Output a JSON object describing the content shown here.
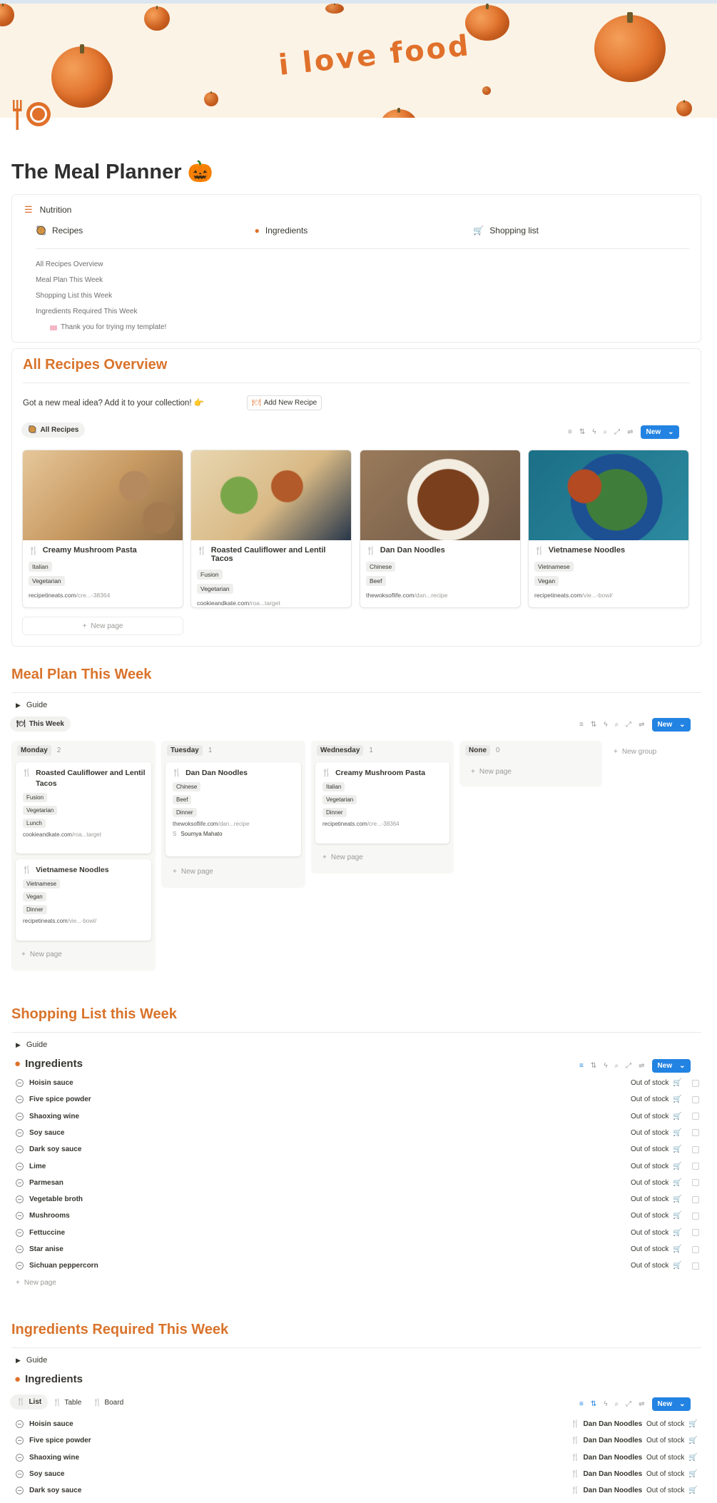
{
  "cover": {
    "text": "i love food"
  },
  "page": {
    "title": "The Meal Planner",
    "title_emoji": "🎃"
  },
  "nutrition": {
    "label": "Nutrition",
    "links": [
      {
        "label": "Recipes"
      },
      {
        "label": "Ingredients"
      },
      {
        "label": "Shopping list"
      }
    ],
    "toc": [
      "All Recipes Overview",
      "Meal Plan This Week",
      "Shopping List this Week",
      "Ingredients Required This Week"
    ],
    "thanks": "Thank you for trying my template!"
  },
  "recipes": {
    "heading": "All Recipes Overview",
    "prompt": "Got a new meal idea? Add it to your collection! 👉",
    "add_button": "Add New Recipe",
    "view": "All Recipes",
    "new_label": "New",
    "new_page": "New page",
    "cards": [
      {
        "title": "Creamy Mushroom Pasta",
        "tags": [
          "Italian",
          "Vegetarian"
        ],
        "url": "recipetineats.com",
        "url_suffix": "/cre...-38364"
      },
      {
        "title": "Roasted Cauliflower and Lentil Tacos",
        "tags": [
          "Fusion",
          "Vegetarian"
        ],
        "url": "cookieandkate.com",
        "url_suffix": "/roa...target"
      },
      {
        "title": "Dan Dan Noodles",
        "tags": [
          "Chinese",
          "Beef"
        ],
        "url": "thewoksoflife.com",
        "url_suffix": "/dan...recipe"
      },
      {
        "title": "Vietnamese Noodles",
        "tags": [
          "Vietnamese",
          "Vegan"
        ],
        "url": "recipetineats.com",
        "url_suffix": "/vie...-bowl/"
      }
    ]
  },
  "mealplan": {
    "heading": "Meal Plan This Week",
    "guide": "Guide",
    "view": "This Week",
    "new_label": "New",
    "new_group": "New group",
    "new_page": "New page",
    "columns": [
      {
        "name": "Monday",
        "count": "2"
      },
      {
        "name": "Tuesday",
        "count": "1"
      },
      {
        "name": "Wednesday",
        "count": "1"
      },
      {
        "name": "None",
        "count": "0"
      }
    ],
    "cards": [
      {
        "title": "Roasted Cauliflower and Lentil Tacos",
        "tags": [
          "Fusion",
          "Vegetarian",
          "Lunch"
        ],
        "url": "cookieandkate.com",
        "url_suffix": "/roa...target"
      },
      {
        "title": "Vietnamese Noodles",
        "tags": [
          "Vietnamese",
          "Vegan",
          "Dinner"
        ],
        "url": "recipetineats.com",
        "url_suffix": "/vie...-bowl/"
      },
      {
        "title": "Dan Dan Noodles",
        "tags": [
          "Chinese",
          "Beef",
          "Dinner"
        ],
        "url": "thewoksoflife.com",
        "url_suffix": "/dan...recipe",
        "person": "Soumya Mahato",
        "person_initial": "S"
      },
      {
        "title": "Creamy Mushroom Pasta",
        "tags": [
          "Italian",
          "Vegetarian",
          "Dinner"
        ],
        "url": "recipetineats.com",
        "url_suffix": "/cre...-38364"
      }
    ]
  },
  "shopping": {
    "heading": "Shopping List this Week",
    "guide": "Guide",
    "db_title": "Ingredients",
    "new_label": "New",
    "status": "Out of stock",
    "new_page": "New page",
    "items": [
      "Hoisin sauce",
      "Five spice powder",
      "Shaoxing wine",
      "Soy sauce",
      "Dark soy sauce",
      "Lime",
      "Parmesan",
      "Vegetable broth",
      "Mushrooms",
      "Fettuccine",
      "Star anise",
      "Sichuan peppercorn"
    ]
  },
  "required": {
    "heading": "Ingredients Required This Week",
    "guide": "Guide",
    "db_title": "Ingredients",
    "tabs": [
      "List",
      "Table",
      "Board"
    ],
    "new_label": "New",
    "recipe": "Dan Dan Noodles",
    "status": "Out of stock",
    "items": [
      "Hoisin sauce",
      "Five spice powder",
      "Shaoxing wine",
      "Soy sauce",
      "Dark soy sauce"
    ]
  },
  "colors": {
    "accent": "#d9732b",
    "button": "#2383e2"
  }
}
